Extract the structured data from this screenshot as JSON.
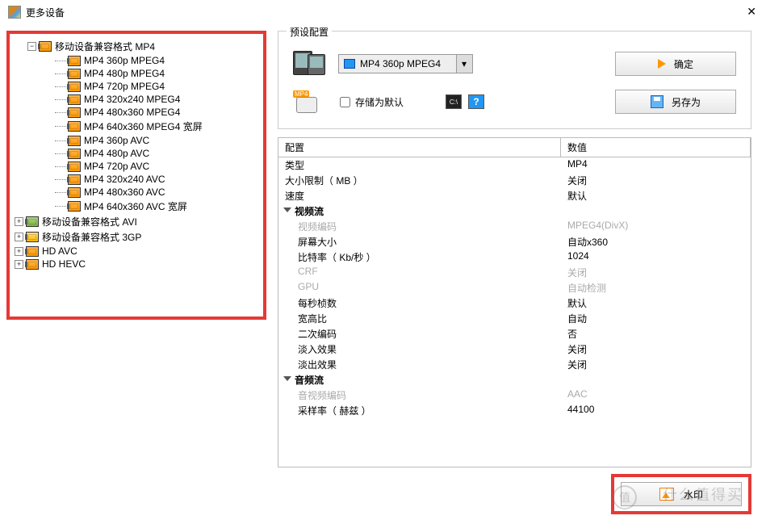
{
  "window": {
    "title": "更多设备"
  },
  "tree": {
    "root": {
      "label": "移动设备兼容格式 MP4"
    },
    "children": [
      "MP4 360p MPEG4",
      "MP4 480p MPEG4",
      "MP4 720p MPEG4",
      "MP4 320x240 MPEG4",
      "MP4 480x360 MPEG4",
      "MP4 640x360 MPEG4 宽屏",
      "MP4 360p AVC",
      "MP4 480p AVC",
      "MP4 720p AVC",
      "MP4 320x240 AVC",
      "MP4 480x360 AVC",
      "MP4 640x360 AVC 宽屏"
    ],
    "siblings": [
      {
        "label": "移动设备兼容格式 AVI",
        "icon": "green"
      },
      {
        "label": "移动设备兼容格式 3GP",
        "icon": "yellow"
      },
      {
        "label": "HD AVC",
        "icon": "orange"
      },
      {
        "label": "HD HEVC",
        "icon": "orange"
      }
    ]
  },
  "preset": {
    "legend": "预设配置",
    "selected": "MP4 360p MPEG4",
    "okLabel": "确定",
    "saveDefaultLabel": "存储为默认",
    "saveAsLabel": "另存为",
    "mp4Tag": "MP4",
    "cmdIcon": "C:\\",
    "helpIcon": "?"
  },
  "grid": {
    "headers": {
      "config": "配置",
      "value": "数值"
    },
    "rows": [
      {
        "k": "类型",
        "v": "MP4"
      },
      {
        "k": "大小限制（ MB ）",
        "v": "关闭"
      },
      {
        "k": "速度",
        "v": "默认"
      },
      {
        "k": "视频流",
        "v": "",
        "section": true
      },
      {
        "k": "视频编码",
        "v": "MPEG4(DivX)",
        "disabled": true,
        "indent": true
      },
      {
        "k": "屏幕大小",
        "v": "自动x360",
        "indent": true
      },
      {
        "k": "比特率（ Kb/秒 ）",
        "v": "1024",
        "indent": true
      },
      {
        "k": "CRF",
        "v": "关闭",
        "disabled": true,
        "indent": true
      },
      {
        "k": "GPU",
        "v": "自动检测",
        "disabled": true,
        "indent": true
      },
      {
        "k": "每秒桢数",
        "v": "默认",
        "indent": true
      },
      {
        "k": "宽高比",
        "v": "自动",
        "indent": true
      },
      {
        "k": "二次编码",
        "v": "否",
        "indent": true
      },
      {
        "k": "淡入效果",
        "v": "关闭",
        "indent": true
      },
      {
        "k": "淡出效果",
        "v": "关闭",
        "indent": true
      },
      {
        "k": "音频流",
        "v": "",
        "section": true
      },
      {
        "k": "音视频编码",
        "v": "AAC",
        "disabled": true,
        "indent": true
      },
      {
        "k": "采样率（ 赫兹 ）",
        "v": "44100",
        "indent": true
      }
    ]
  },
  "bottom": {
    "watermarkBtn": "水印"
  },
  "bg_watermark": {
    "text": "什么值得买",
    "logo": "值"
  }
}
